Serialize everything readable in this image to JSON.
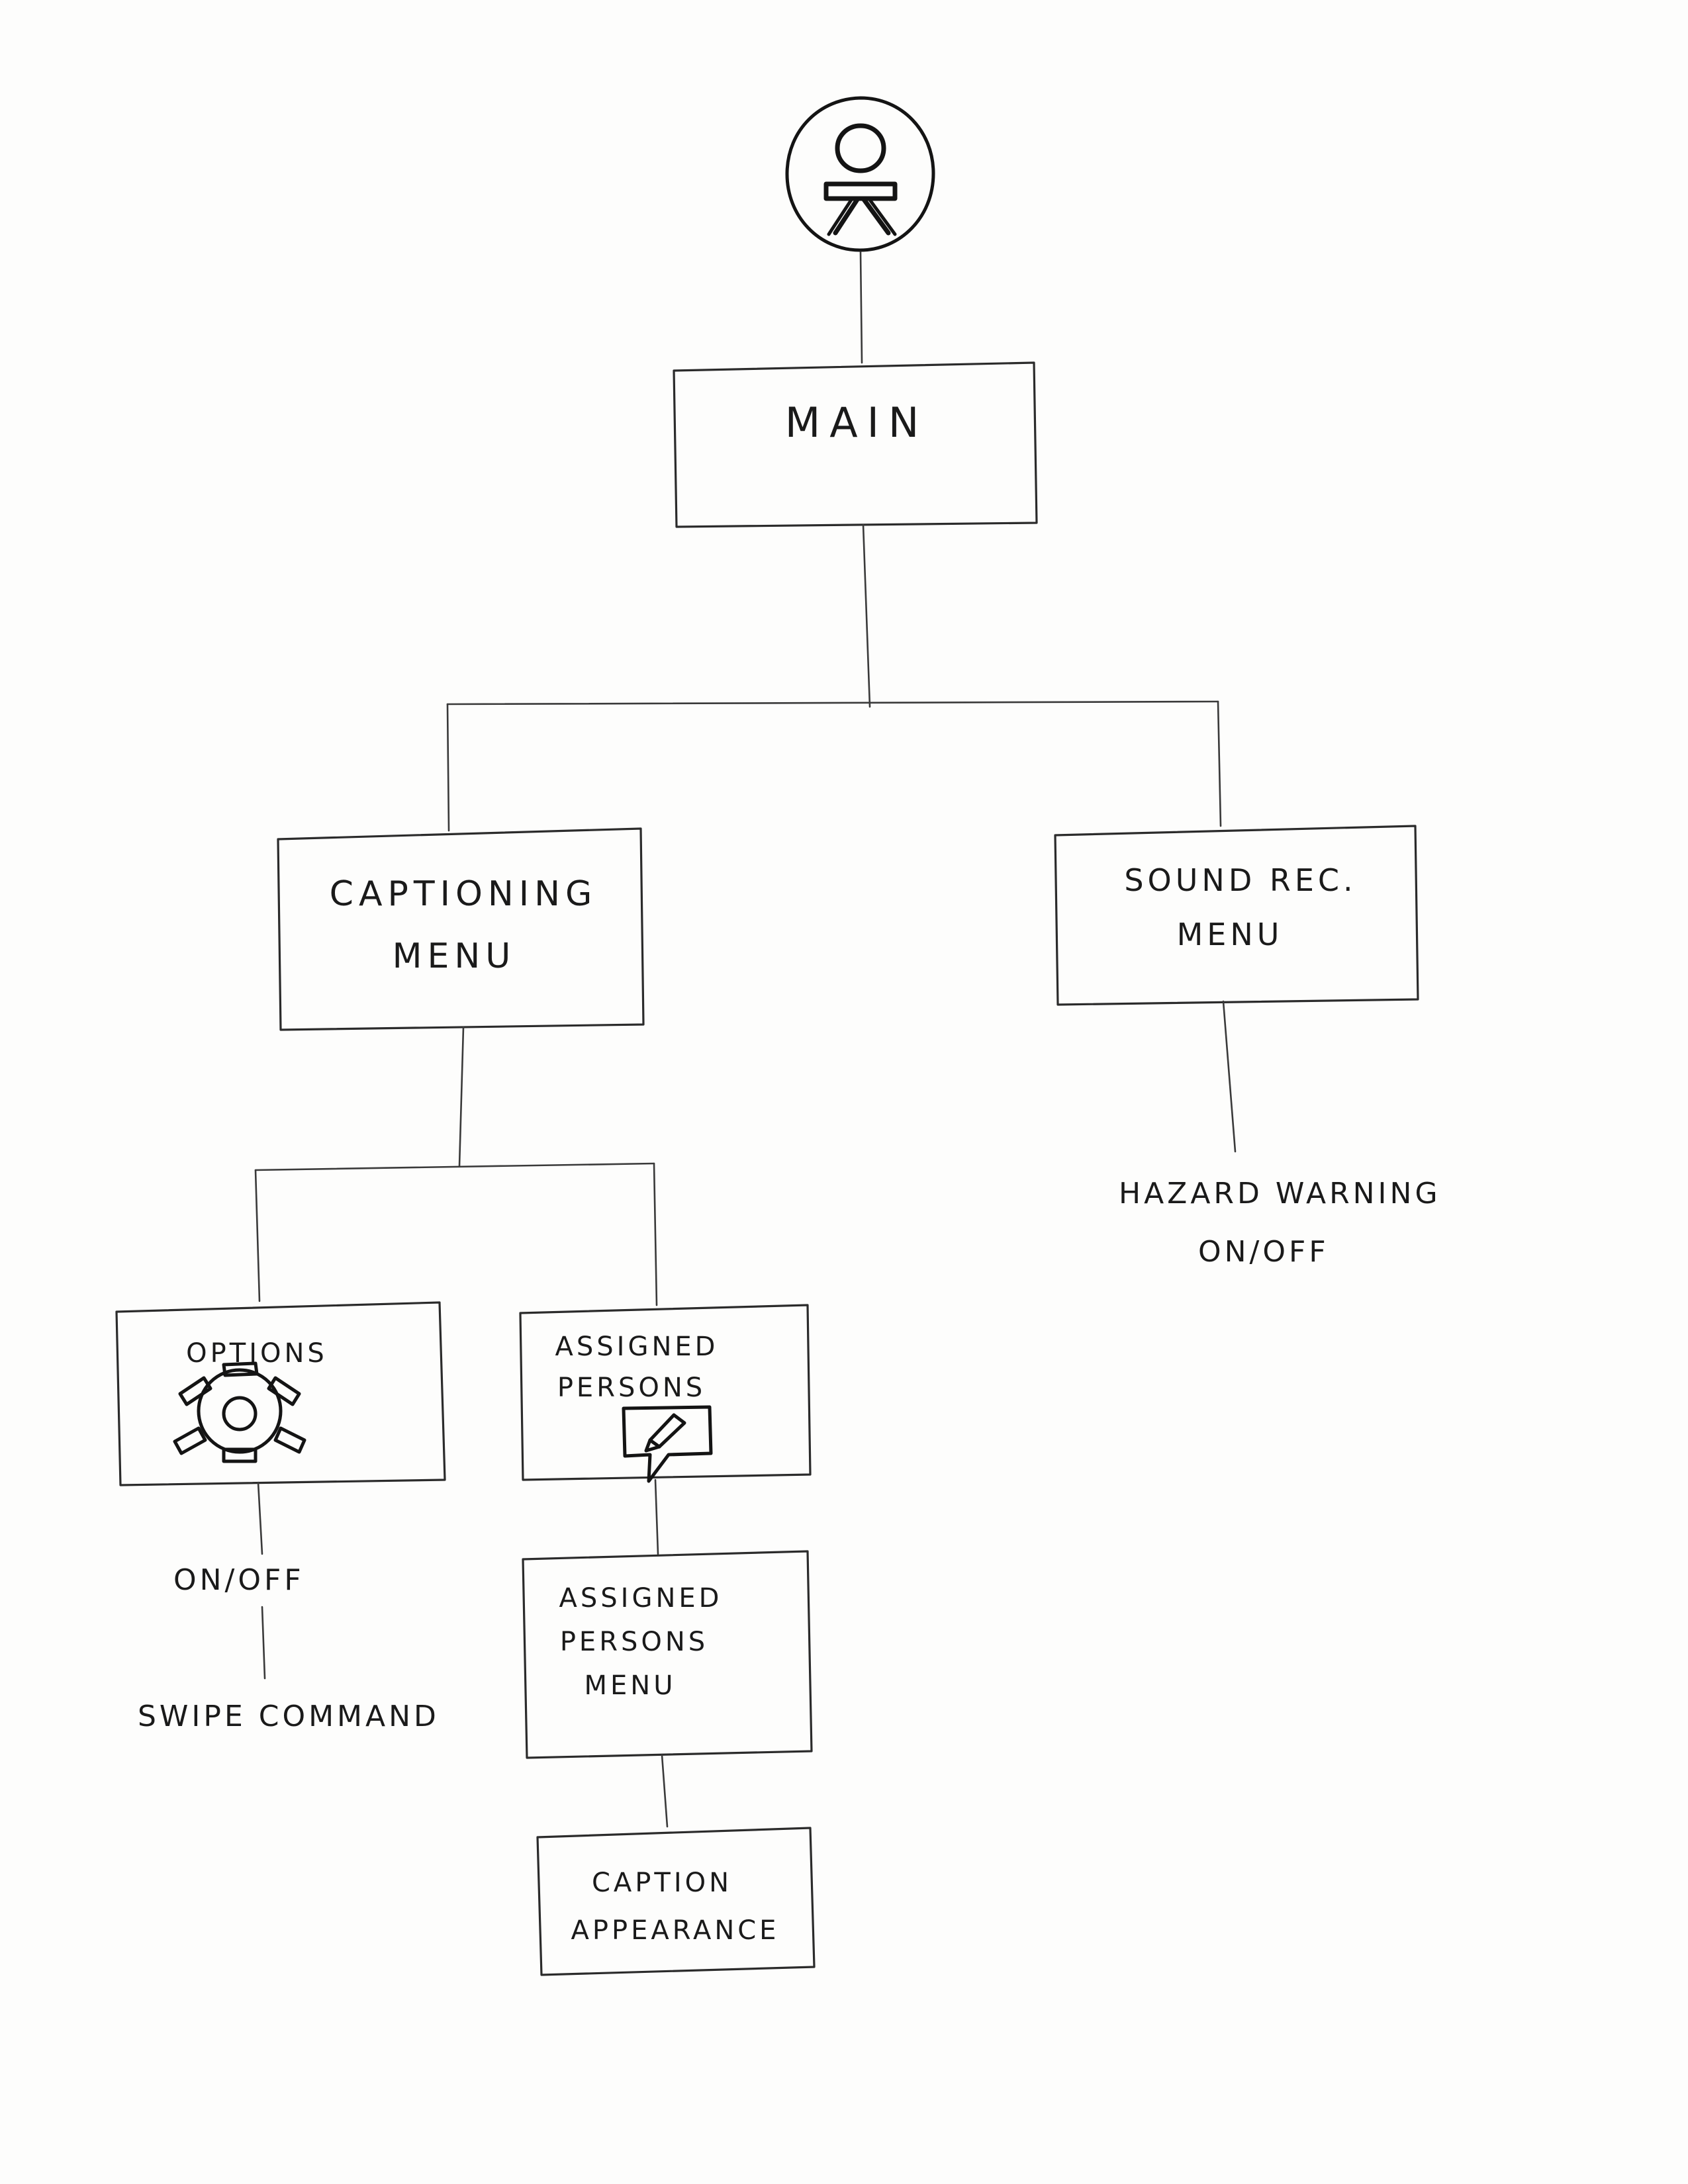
{
  "diagram": {
    "title": "Captioning System Menu Hierarchy",
    "style": "hand-drawn pencil sketch on white paper",
    "ink_color": "#2b2b2b",
    "paper_color": "#fdfdfc"
  },
  "root_icon": {
    "name": "accessibility-person-icon",
    "description": "circle containing a stick-figure person glyph"
  },
  "nodes": {
    "main": {
      "label": "MAIN"
    },
    "captioning_menu": {
      "line1": "CAPTIONING",
      "line2": "MENU"
    },
    "sound_rec_menu": {
      "line1": "SOUND REC.",
      "line2": "MENU"
    },
    "options": {
      "label": "OPTIONS",
      "icon": "gear-icon"
    },
    "assigned_persons": {
      "line1": "ASSIGNED",
      "line2": "PERSONS",
      "icon": "caption-edit-bubble-icon"
    },
    "assigned_persons_menu": {
      "line1": "ASSIGNED",
      "line2": "PERSONS",
      "line3": "MENU"
    },
    "caption_appearance": {
      "line1": "CAPTION",
      "line2": "APPEARANCE"
    }
  },
  "leaf_labels": {
    "hazard_warning": {
      "line1": "HAZARD WARNING",
      "line2": "ON/OFF"
    },
    "options_on_off": {
      "label": "ON/OFF"
    },
    "swipe_command": {
      "label": "SWIPE COMMAND"
    }
  }
}
